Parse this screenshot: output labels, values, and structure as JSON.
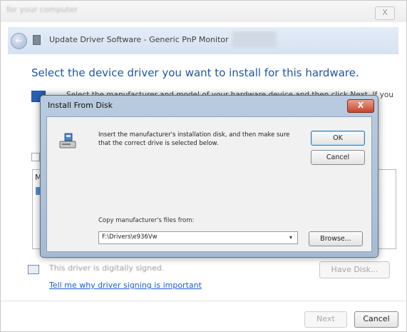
{
  "wizard": {
    "blurred_title": "for your computer",
    "close_glyph": "X",
    "window_title": "Update Driver Software - Generic PnP Monitor",
    "back_glyph": "←",
    "heading": "Select the device driver you want to install for this hardware.",
    "subline": "Select the manufacturer and model of your hardware device and then click Next. If you",
    "list_letter": "M",
    "signing_text": "This driver is digitally signed.",
    "signing_link": "Tell me why driver signing is important",
    "have_disk_label": "Have Disk...",
    "next_label": "Next",
    "cancel_label": "Cancel"
  },
  "dialog": {
    "title": "Install From Disk",
    "close_glyph": "X",
    "message": "Insert the manufacturer's installation disk, and then make sure that the correct drive is selected below.",
    "ok_label": "OK",
    "cancel_label": "Cancel",
    "copy_label": "Copy manufacturer's files from:",
    "path_value": "F:\\Drivers\\e936Vw",
    "dropdown_glyph": "▾",
    "browse_label": "Browse..."
  },
  "icons": {
    "disk": "disk-drive-icon",
    "monitor": "monitor-icon",
    "shield": "driver-sign-icon",
    "back": "back-arrow-icon"
  }
}
